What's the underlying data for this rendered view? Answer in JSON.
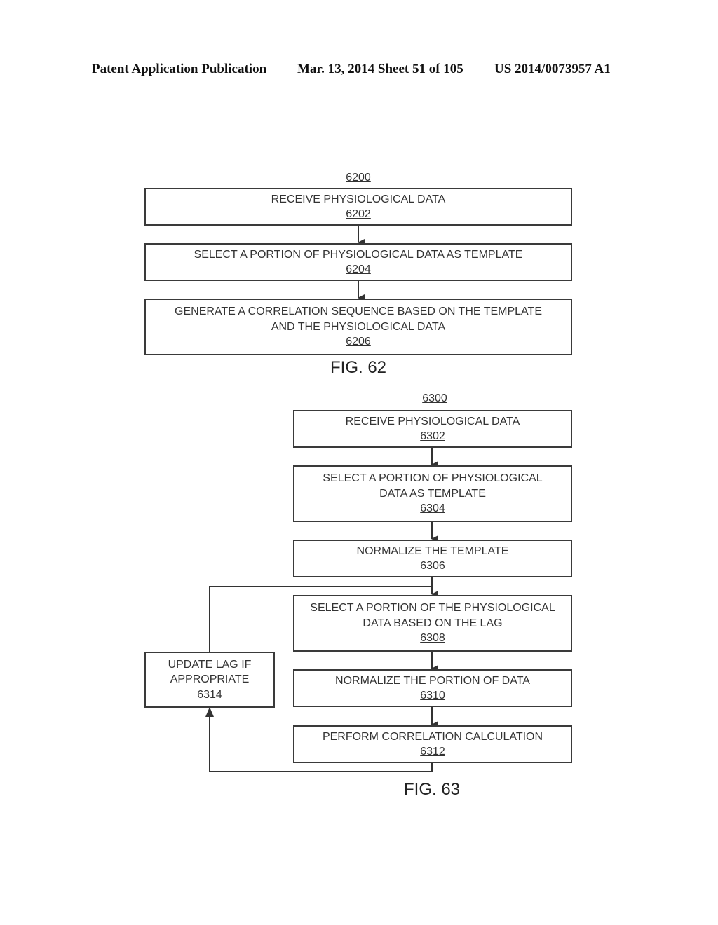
{
  "header": {
    "publication": "Patent Application Publication",
    "date_sheet": "Mar. 13, 2014  Sheet 51 of 105",
    "number": "US 2014/0073957 A1"
  },
  "fig62": {
    "ref": "6200",
    "caption": "FIG. 62",
    "steps": [
      {
        "lines": [
          "RECEIVE PHYSIOLOGICAL DATA"
        ],
        "num": "6202"
      },
      {
        "lines": [
          "SELECT A PORTION OF PHYSIOLOGICAL DATA AS TEMPLATE"
        ],
        "num": "6204"
      },
      {
        "lines": [
          "GENERATE A CORRELATION SEQUENCE BASED ON THE TEMPLATE",
          "AND THE PHYSIOLOGICAL DATA"
        ],
        "num": "6206"
      }
    ]
  },
  "fig63": {
    "ref": "6300",
    "caption": "FIG. 63",
    "steps": [
      {
        "lines": [
          "RECEIVE PHYSIOLOGICAL DATA"
        ],
        "num": "6302"
      },
      {
        "lines": [
          "SELECT A PORTION OF PHYSIOLOGICAL",
          "DATA AS TEMPLATE"
        ],
        "num": "6304"
      },
      {
        "lines": [
          "NORMALIZE THE TEMPLATE"
        ],
        "num": "6306"
      },
      {
        "lines": [
          "SELECT A PORTION OF THE PHYSIOLOGICAL",
          "DATA BASED ON THE LAG"
        ],
        "num": "6308"
      },
      {
        "lines": [
          "NORMALIZE THE PORTION OF DATA"
        ],
        "num": "6310"
      },
      {
        "lines": [
          "PERFORM CORRELATION CALCULATION"
        ],
        "num": "6312"
      },
      {
        "lines": [
          "UPDATE LAG IF",
          "APPROPRIATE"
        ],
        "num": "6314"
      }
    ]
  }
}
